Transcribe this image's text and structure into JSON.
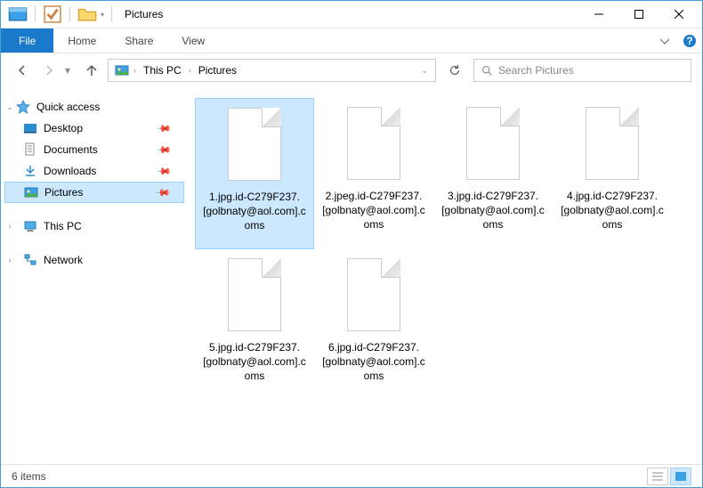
{
  "window": {
    "title": "Pictures"
  },
  "ribbon": {
    "file": "File",
    "tabs": [
      "Home",
      "Share",
      "View"
    ]
  },
  "nav": {
    "breadcrumbs": [
      "This PC",
      "Pictures"
    ],
    "search_placeholder": "Search Pictures"
  },
  "sidebar": {
    "quick_access": "Quick access",
    "items": [
      {
        "label": "Desktop",
        "icon": "desktop"
      },
      {
        "label": "Documents",
        "icon": "documents"
      },
      {
        "label": "Downloads",
        "icon": "downloads"
      },
      {
        "label": "Pictures",
        "icon": "pictures",
        "selected": true
      }
    ],
    "this_pc": "This PC",
    "network": "Network"
  },
  "files": [
    {
      "name": "1.jpg.id-C279F237.[golbnaty@aol.com].coms",
      "selected": true
    },
    {
      "name": "2.jpeg.id-C279F237.[golbnaty@aol.com].coms"
    },
    {
      "name": "3.jpg.id-C279F237.[golbnaty@aol.com].coms"
    },
    {
      "name": "4.jpg.id-C279F237.[golbnaty@aol.com].coms"
    },
    {
      "name": "5.jpg.id-C279F237.[golbnaty@aol.com].coms"
    },
    {
      "name": "6.jpg.id-C279F237.[golbnaty@aol.com].coms"
    }
  ],
  "status": {
    "count": "6 items"
  }
}
